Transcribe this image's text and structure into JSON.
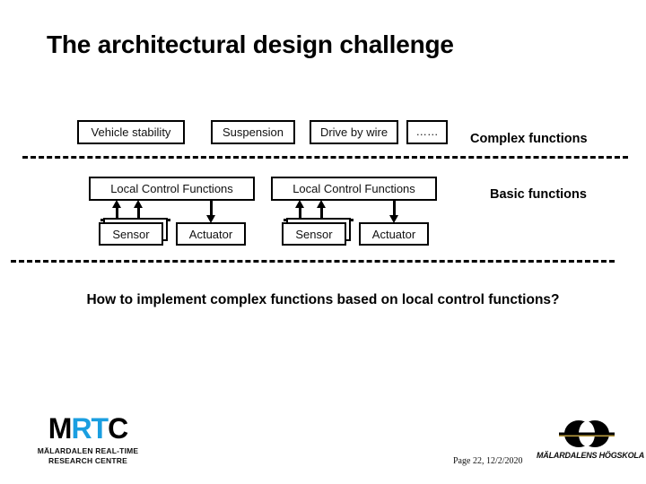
{
  "slide": {
    "title": "The architectural design challenge",
    "question": "How to implement complex functions based on local control functions?"
  },
  "complex_layer": {
    "label": "Complex functions",
    "boxes": [
      {
        "label": "Vehicle stability"
      },
      {
        "label": "Suspension"
      },
      {
        "label": "Drive by wire"
      },
      {
        "label": "……"
      }
    ]
  },
  "basic_layer": {
    "label": "Basic functions",
    "groups": [
      {
        "controller": "Local Control Functions",
        "sensor": "Sensor",
        "actuator": "Actuator"
      },
      {
        "controller": "Local Control Functions",
        "sensor": "Sensor",
        "actuator": "Actuator"
      }
    ]
  },
  "logos": {
    "mrtc": {
      "letters_black_1": "M",
      "letters_blue": "RT",
      "letters_black_2": "C",
      "subtitle_line1": "MÄLARDALEN REAL-TIME",
      "subtitle_line2": "RESEARCH CENTRE",
      "accent_color": "#1a9ee0"
    },
    "mdh": {
      "wordmark": "MÄLARDALENS HÖGSKOLA"
    }
  },
  "footer": {
    "page_text": "Page 22, 12/2/2020"
  }
}
